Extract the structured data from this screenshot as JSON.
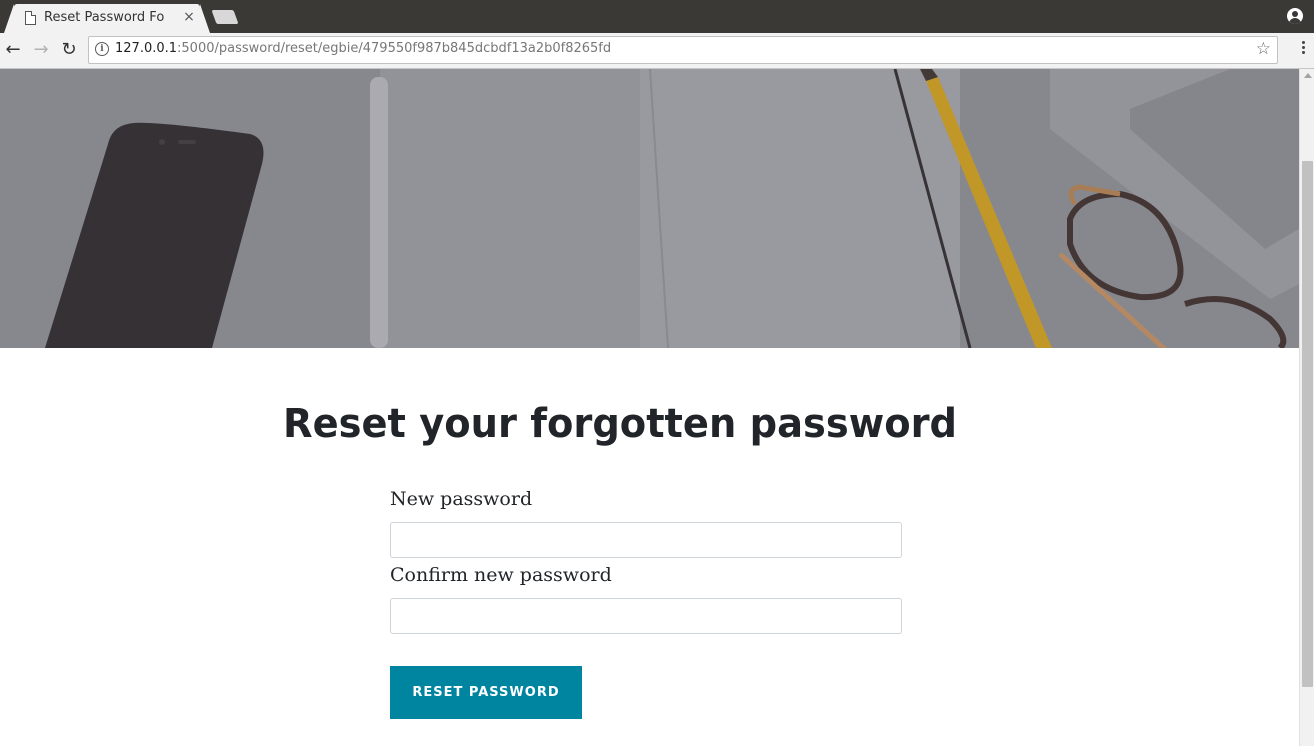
{
  "browser": {
    "tab": {
      "title": "Reset Password Fo",
      "close_glyph": "×",
      "icon": "file-icon"
    },
    "new_tab_icon": "new-tab-icon",
    "profile_icon": "account-circle-icon",
    "nav": {
      "back_glyph": "←",
      "forward_glyph": "→",
      "reload_glyph": "↻"
    },
    "address": {
      "host": "127.0.0.1",
      "path": ":5000/password/reset/egbie/479550f987b845dcbdf13a2b0f8265fd",
      "info_icon": "info-icon",
      "star_glyph": "☆"
    },
    "menu_icon": "more-vert-icon"
  },
  "page": {
    "hero": {
      "description_icon": "header-image",
      "overlay_color": "#8c8d92"
    },
    "heading": "Reset your forgotten password",
    "form": {
      "new_password_label": "New password",
      "new_password_value": "",
      "confirm_password_label": "Confirm new password",
      "confirm_password_value": "",
      "submit_label": "RESET PASSWORD"
    }
  },
  "colors": {
    "accent": "#0085a1",
    "heading_text": "#212529",
    "tabbar": "#3b3935",
    "toolbar": "#f2f2f2"
  }
}
